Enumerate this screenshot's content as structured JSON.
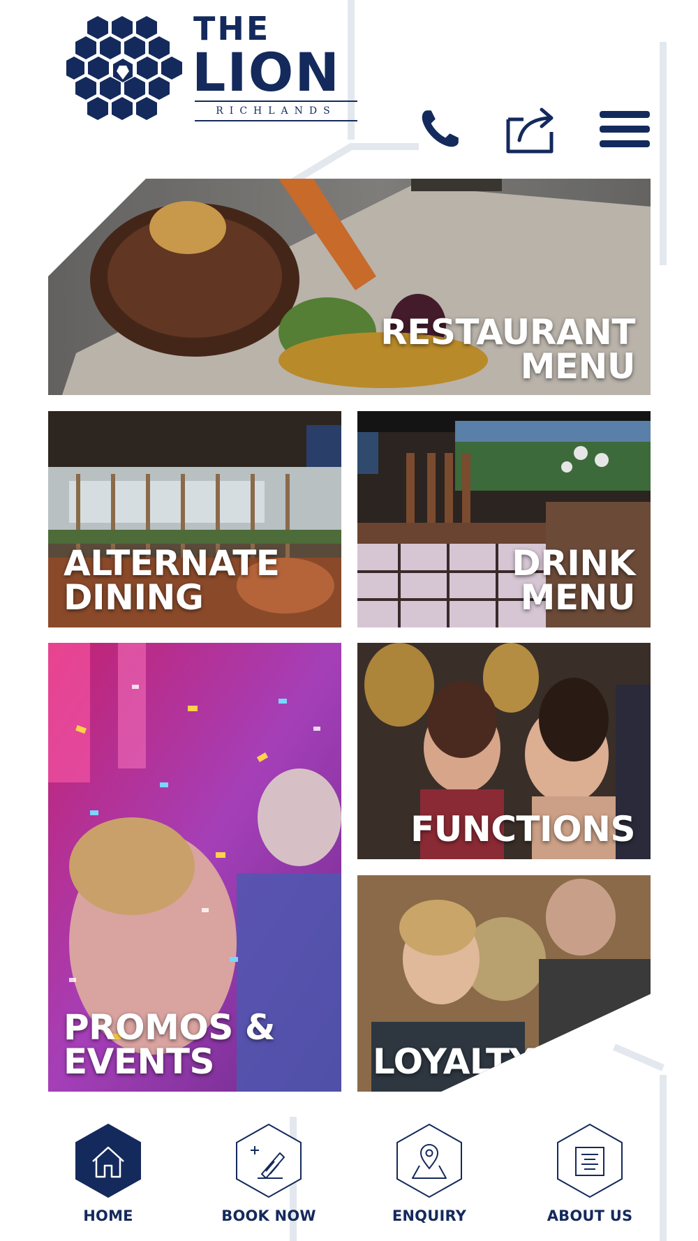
{
  "brand": {
    "name_line1": "THE",
    "name_line2": "LION",
    "location": "RICHLANDS",
    "color": "#142a5c"
  },
  "header_actions": [
    {
      "name": "phone",
      "icon": "phone-icon"
    },
    {
      "name": "share",
      "icon": "share-icon"
    },
    {
      "name": "menu",
      "icon": "hamburger-menu-icon"
    }
  ],
  "tiles": {
    "restaurant": {
      "line1": "RESTAURANT",
      "line2": "MENU"
    },
    "alternate_dining": {
      "line1": "ALTERNATE",
      "line2": "DINING"
    },
    "drink": {
      "line1": "DRINK",
      "line2": "MENU"
    },
    "promos": {
      "line1": "PROMOS &",
      "line2": "EVENTS"
    },
    "functions": {
      "line1": "FUNCTIONS"
    },
    "loyalty": {
      "line1": "LOYALTY"
    }
  },
  "bottom_nav": {
    "home": {
      "label": "HOME",
      "icon": "home-icon",
      "active": true
    },
    "book_now": {
      "label": "BOOK NOW",
      "icon": "pencil-book-icon",
      "active": false
    },
    "enquiry": {
      "label": "ENQUIRY",
      "icon": "map-pin-icon",
      "active": false
    },
    "about_us": {
      "label": "ABOUT US",
      "icon": "document-lines-icon",
      "active": false
    }
  }
}
